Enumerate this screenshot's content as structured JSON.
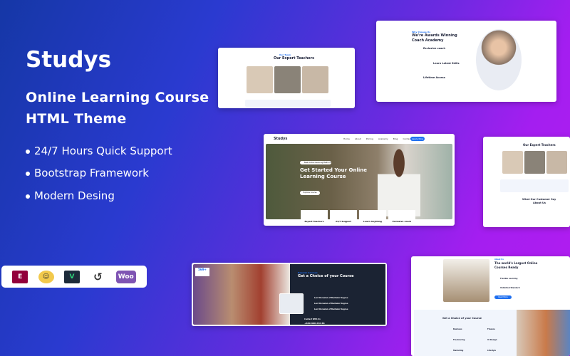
{
  "brand": {
    "title": "Studys",
    "subtitle_line1": "Online Learning Course",
    "subtitle_line2": "HTML Theme"
  },
  "features": [
    "24/7 Hours Quick Support",
    "Bootstrap Framework",
    "Modern Desing"
  ],
  "plugins": [
    {
      "name": "Elementor",
      "icon": "elementor-icon",
      "color": "#92003b"
    },
    {
      "name": "Mailchimp",
      "icon": "mailchimp-icon",
      "color": "#f2c94c"
    },
    {
      "name": "Visual Composer",
      "icon": "visual-composer-icon",
      "color": "#1d2b3a"
    },
    {
      "name": "Revolution Slider",
      "icon": "slider-revolution-icon",
      "color": "#333333"
    },
    {
      "name": "WooCommerce",
      "label": "Woo",
      "icon": "woocommerce-icon",
      "color": "#7f54b3"
    }
  ],
  "mockups": {
    "teachers": {
      "tag": "Our Team",
      "heading": "Our Expert Teachers"
    },
    "awards": {
      "tag": "Why Choose Us",
      "heading1": "We're Awards Winning",
      "heading2": "Coach Academy",
      "items": [
        "Exclusive coach",
        "Learn Latest Skills",
        "Lifetime Access"
      ]
    },
    "hero": {
      "logo": "Studys",
      "nav": [
        "Home",
        "About",
        "Pricing",
        "Academy",
        "Blog",
        "Contact"
      ],
      "cta": "Apply Now",
      "badge": "Best Online Learning Platform",
      "heading1": "Get Started Your Online",
      "heading2": "Learning Course",
      "button": "Explore Course",
      "features": [
        "Expert Teachers",
        "24/7 Support",
        "Learn Anything",
        "Exclusive coach"
      ]
    },
    "teachers2": {
      "heading": "Our Expert Teachers",
      "testimonial1": "What Our Customer Say",
      "testimonial2": "About Us"
    },
    "choice": {
      "badge": "569+",
      "tag": "Popular Courses",
      "heading": "Get a Choice of your Course",
      "items": [
        "Last Occasion of Bachelor Degree",
        "Last Occasion of Bachelor Degree",
        "Last Occasion of Bachelor Degree"
      ],
      "contact_label": "Contact With Us",
      "phone": "+880 888 236 88"
    },
    "largest": {
      "tag": "About Us",
      "heading1": "The world's Largest Online",
      "heading2": "Courses Ready",
      "items": [
        "Flexible Learning",
        "Unlimited Standard"
      ],
      "button": "Read More",
      "choice_heading": "Get a Choice of your Course",
      "categories": [
        "Business",
        "Finance",
        "Freelancing",
        "UI Design",
        "Marketing",
        "Lifestyle"
      ]
    }
  },
  "colors": {
    "accent": "#1e6ff0",
    "dark": "#1b2333"
  }
}
